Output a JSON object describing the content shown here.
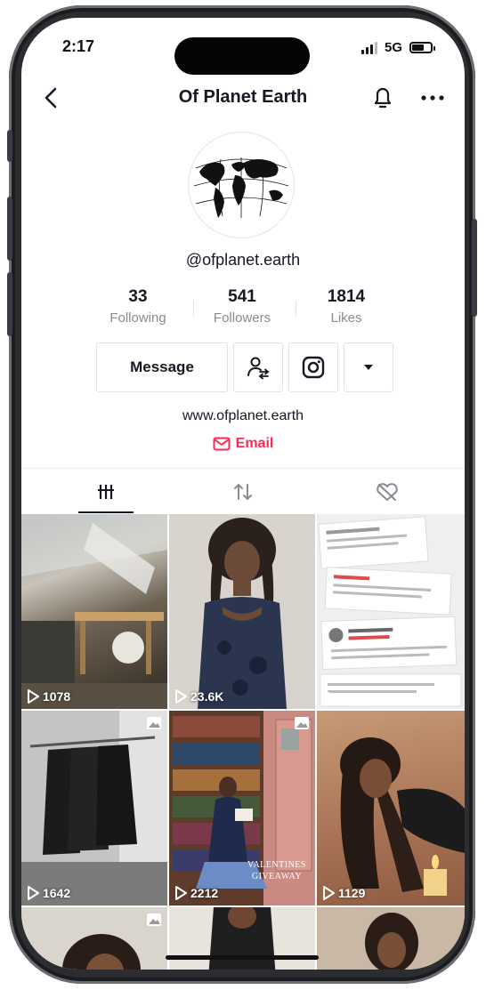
{
  "status": {
    "time": "2:17",
    "network": "5G"
  },
  "header": {
    "title": "Of Planet Earth"
  },
  "profile": {
    "handle": "@ofplanet.earth",
    "stats": [
      {
        "value": "33",
        "label": "Following"
      },
      {
        "value": "541",
        "label": "Followers"
      },
      {
        "value": "1814",
        "label": "Likes"
      }
    ],
    "message_label": "Message",
    "website": "www.ofplanet.earth",
    "email_label": "Email"
  },
  "grid": [
    {
      "views": "1078",
      "type": "video"
    },
    {
      "views": "23.6K",
      "type": "video"
    },
    {
      "views": "",
      "type": "video"
    },
    {
      "views": "1642",
      "type": "photo"
    },
    {
      "views": "2212",
      "type": "photo",
      "overlay_text": "VALENTINES GIVEAWAY"
    },
    {
      "views": "1129",
      "type": "video"
    },
    {
      "views": "",
      "type": "photo"
    },
    {
      "views": "",
      "type": "video"
    },
    {
      "views": "",
      "type": "video"
    }
  ],
  "colors": {
    "accent": "#fe2c55",
    "text": "#161823",
    "muted": "#8a8b91"
  }
}
